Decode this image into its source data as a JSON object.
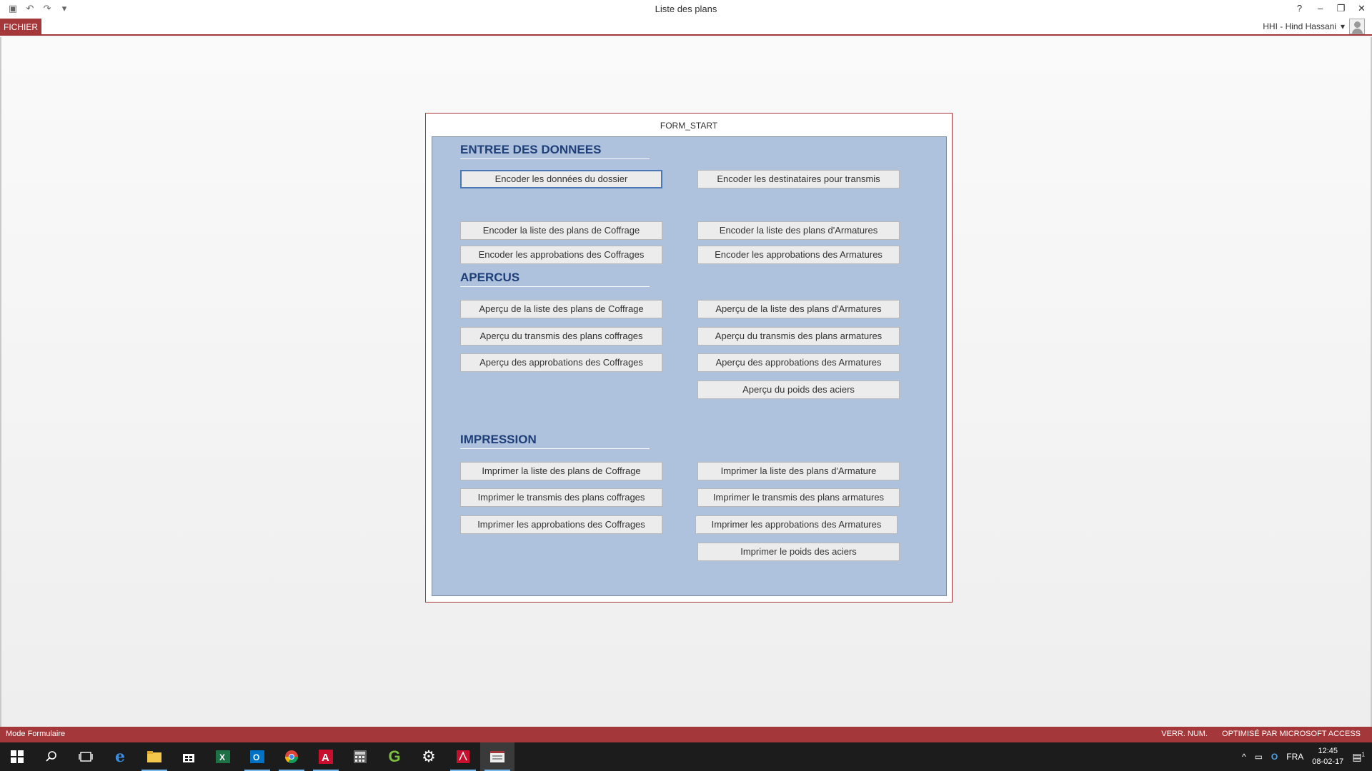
{
  "window": {
    "title": "Liste des plans",
    "help": "?",
    "minimize": "–",
    "restore": "❐",
    "close": "✕"
  },
  "ribbon": {
    "file_tab": "FICHIER",
    "user_name": "HHI - Hind Hassani",
    "user_caret": "▾"
  },
  "form": {
    "title": "FORM_START",
    "sections": {
      "entree": "ENTREE DES DONNEES",
      "apercus": "APERCUS",
      "impression": "IMPRESSION"
    },
    "buttons": {
      "encoder_dossier": "Encoder les données du dossier",
      "encoder_destinataires": "Encoder les destinataires pour transmis",
      "encoder_liste_coffrage": "Encoder la liste des plans de Coffrage",
      "encoder_liste_armatures": "Encoder la liste des plans d'Armatures",
      "encoder_approb_coffrages": "Encoder les approbations des Coffrages",
      "encoder_approb_armatures": "Encoder les approbations des Armatures",
      "apercu_liste_coffrage": "Aperçu de la liste des plans de Coffrage",
      "apercu_liste_armatures": "Aperçu de la liste des plans d'Armatures",
      "apercu_transmis_coffrages": "Aperçu du transmis des plans coffrages",
      "apercu_transmis_armatures": "Aperçu du transmis des plans armatures",
      "apercu_approb_coffrages": "Aperçu des approbations des Coffrages",
      "apercu_approb_armatures": "Aperçu des approbations des Armatures",
      "apercu_poids_aciers": "Aperçu du poids des aciers",
      "imprimer_liste_coffrage": "Imprimer la liste des plans de Coffrage",
      "imprimer_liste_armature": "Imprimer la liste des plans d'Armature",
      "imprimer_transmis_coffrages": "Imprimer le transmis des plans coffrages",
      "imprimer_transmis_armatures": "Imprimer le transmis des plans armatures",
      "imprimer_approb_coffrages": "Imprimer les approbations des Coffrages",
      "imprimer_approb_armatures": "Imprimer les approbations des Armatures",
      "imprimer_poids_aciers": "Imprimer le poids des aciers"
    }
  },
  "statusbar": {
    "mode": "Mode Formulaire",
    "numlock": "VERR. NUM.",
    "optimized": "OPTIMISÉ PAR MICROSOFT ACCESS"
  },
  "taskbar": {
    "language": "FRA",
    "time": "12:45",
    "date": "08-02-17",
    "notifications": "1"
  },
  "colors": {
    "accent": "#a4373a",
    "form_background": "#afc2dd",
    "section_title": "#1f3f78"
  }
}
